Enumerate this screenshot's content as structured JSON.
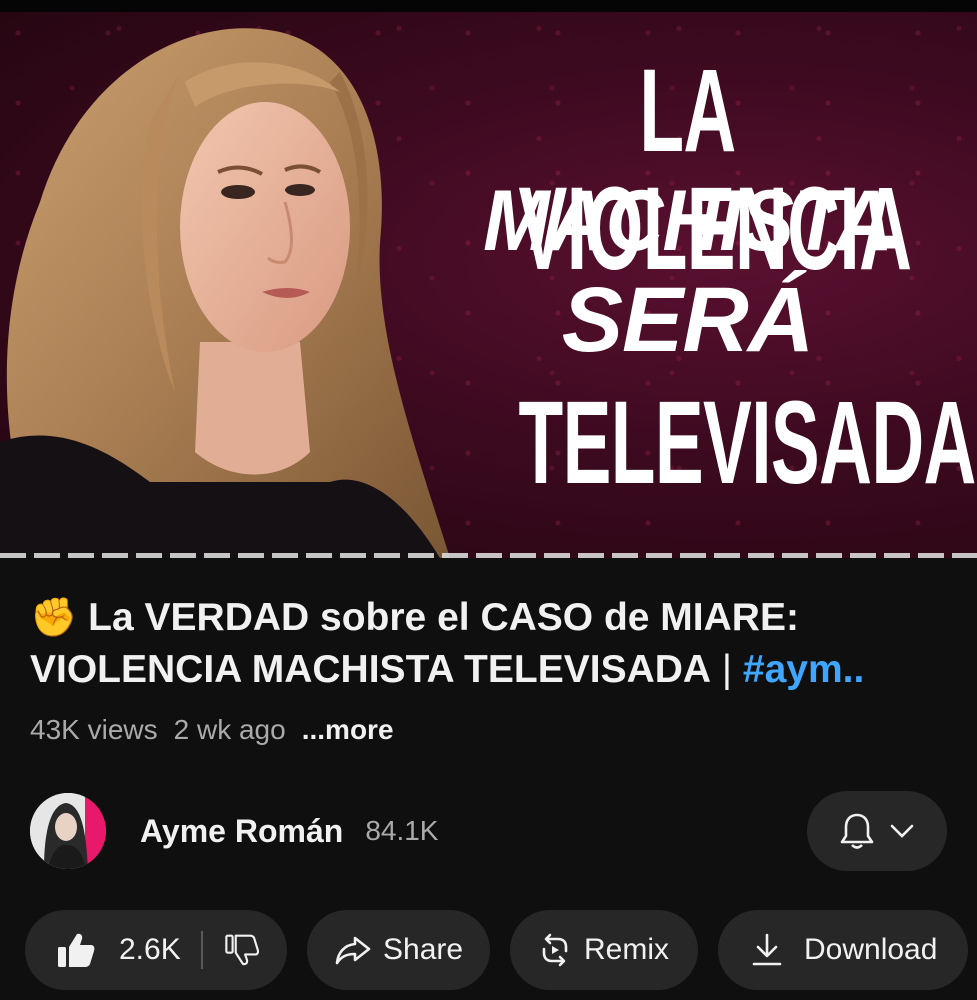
{
  "video": {
    "thumbnail_text": {
      "line1": "LA VIOLENCIA",
      "line2": "MACHISTA",
      "line3": "SERÁ",
      "line4": "TELEVISADA"
    },
    "title_emoji": "✊",
    "title_main": "La VERDAD sobre el CASO de MIARE: VIOLENCIA MACHISTA TELEVISADA",
    "title_separator": " | ",
    "title_hashtag": "#aym..",
    "views": "43K views",
    "age": "2 wk ago",
    "more_label": "...more"
  },
  "channel": {
    "name": "Ayme Román",
    "subscribers": "84.1K",
    "bell_icon": "bell-icon",
    "dropdown_icon": "chevron-down-icon"
  },
  "actions": {
    "like_count": "2.6K",
    "share_label": "Share",
    "remix_label": "Remix",
    "download_label": "Download"
  },
  "colors": {
    "background": "#0f0f0f",
    "pill": "#272727",
    "hashtag": "#3ea6ff",
    "thumbnail_bg": "#3d0a20",
    "avatar_accent": "#e8196a"
  }
}
